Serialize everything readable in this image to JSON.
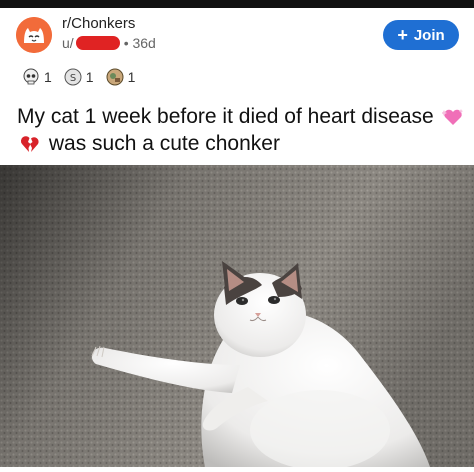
{
  "post": {
    "subreddit": "r/Chonkers",
    "user_prefix": "u/",
    "age": "36d",
    "join_label": "Join",
    "awards": [
      {
        "icon": "skull-award-icon",
        "count": "1"
      },
      {
        "icon": "silver-coin-award-icon",
        "count": "1"
      },
      {
        "icon": "helpful-award-icon",
        "count": "1"
      }
    ],
    "title_part1": "My cat 1 week before it died of heart disease",
    "title_part2": "was such a cute chonker",
    "title_emojis": [
      "sparkling-heart-icon",
      "broken-heart-icon"
    ]
  },
  "colors": {
    "join_button": "#1f6fd3",
    "avatar_bg": "#f26b3a",
    "redaction": "#e02323"
  }
}
